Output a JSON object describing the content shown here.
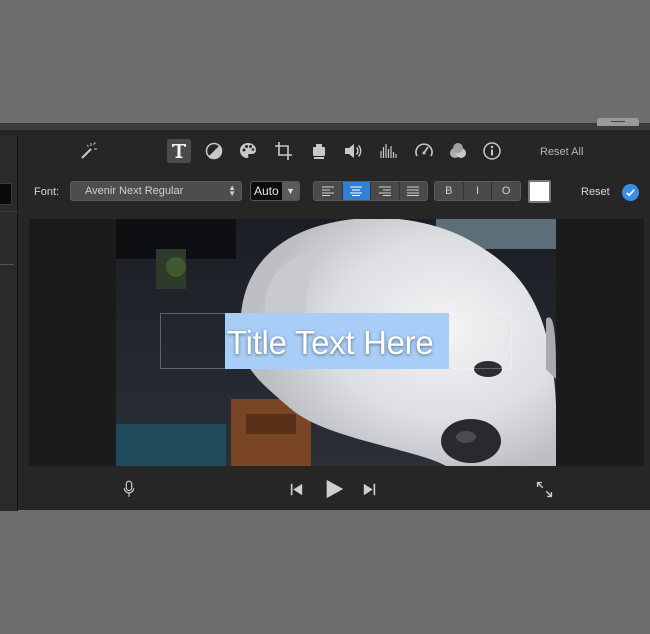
{
  "toolbar": {
    "reset_all_label": "Reset All",
    "tools": [
      {
        "icon": "magic-wand-icon"
      },
      {
        "icon": "title-text-icon",
        "active": true
      },
      {
        "icon": "color-balance-icon"
      },
      {
        "icon": "color-palette-icon"
      },
      {
        "icon": "crop-icon"
      },
      {
        "icon": "stabilization-camera-icon"
      },
      {
        "icon": "volume-icon"
      },
      {
        "icon": "equalizer-icon"
      },
      {
        "icon": "speed-gauge-icon"
      },
      {
        "icon": "video-filter-icon"
      },
      {
        "icon": "info-icon"
      }
    ]
  },
  "title_settings": {
    "font_label": "Font:",
    "font_value": "Avenir Next Regular",
    "size_value": "Auto",
    "alignment": {
      "options": [
        "left",
        "center",
        "right",
        "justify"
      ],
      "selected": "center"
    },
    "style_buttons": [
      "B",
      "I",
      "O"
    ],
    "text_color": "#ffffff",
    "reset_label": "Reset"
  },
  "viewer": {
    "title_text": "Title Text Here"
  },
  "playback": {
    "controls": [
      "microphone-icon",
      "skip-back-icon",
      "play-icon",
      "skip-forward-icon",
      "fullscreen-icon"
    ]
  },
  "colors": {
    "accent": "#2f7fd3",
    "selection_highlight": "#a8cdf6",
    "panel_bg": "#262626"
  }
}
